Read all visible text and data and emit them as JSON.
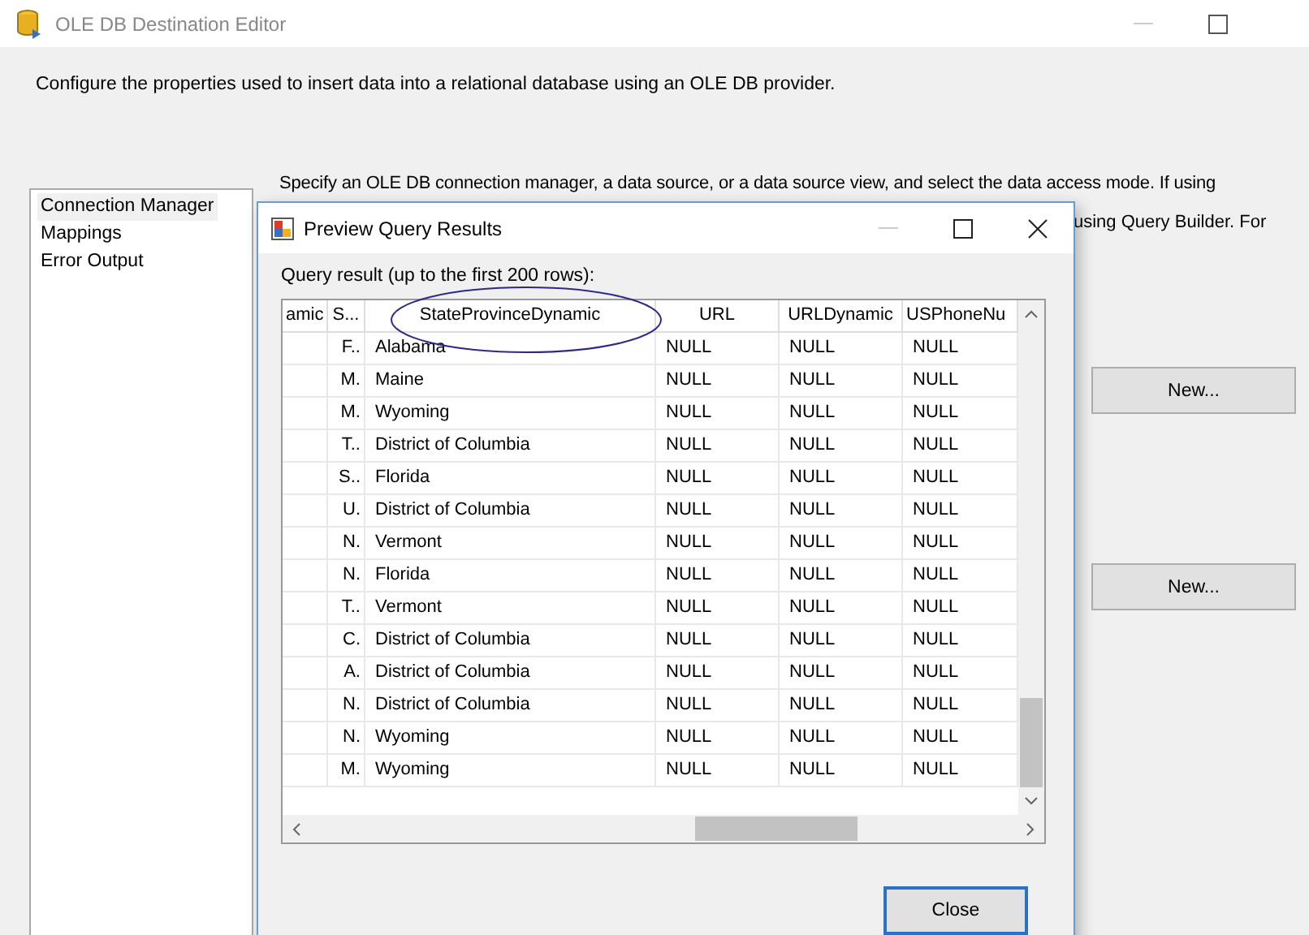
{
  "window": {
    "title": "OLE DB Destination Editor"
  },
  "description": "Configure the properties used to insert data into a relational database using an OLE DB provider.",
  "sidebar": {
    "items": [
      {
        "label": "Connection Manager",
        "selected": true
      },
      {
        "label": "Mappings",
        "selected": false
      },
      {
        "label": "Error Output",
        "selected": false
      }
    ]
  },
  "content": {
    "text_lines": [
      "Specify an OLE DB connection manager, a data source, or a data source view, and select the data access mode. If using",
      "using Query Builder. For"
    ],
    "buttons": [
      "New...",
      "New..."
    ]
  },
  "dialog": {
    "title": "Preview Query Results",
    "label": "Query result (up to the first 200 rows):",
    "table": {
      "columns": [
        "amic",
        "S...",
        "StateProvinceDynamic",
        "URL",
        "URLDynamic",
        "USPhoneNu"
      ],
      "rows": [
        [
          "",
          "F..",
          "Alabama",
          "NULL",
          "NULL",
          "NULL"
        ],
        [
          "",
          "M.",
          "Maine",
          "NULL",
          "NULL",
          "NULL"
        ],
        [
          "",
          "M.",
          "Wyoming",
          "NULL",
          "NULL",
          "NULL"
        ],
        [
          "",
          "T..",
          "District of Columbia",
          "NULL",
          "NULL",
          "NULL"
        ],
        [
          "",
          "S..",
          "Florida",
          "NULL",
          "NULL",
          "NULL"
        ],
        [
          "",
          "U.",
          "District of Columbia",
          "NULL",
          "NULL",
          "NULL"
        ],
        [
          "",
          "N.",
          "Vermont",
          "NULL",
          "NULL",
          "NULL"
        ],
        [
          "",
          "N.",
          "Florida",
          "NULL",
          "NULL",
          "NULL"
        ],
        [
          "",
          "T..",
          "Vermont",
          "NULL",
          "NULL",
          "NULL"
        ],
        [
          "",
          "C.",
          "District of Columbia",
          "NULL",
          "NULL",
          "NULL"
        ],
        [
          "",
          "A.",
          "District of Columbia",
          "NULL",
          "NULL",
          "NULL"
        ],
        [
          "",
          "N.",
          "District of Columbia",
          "NULL",
          "NULL",
          "NULL"
        ],
        [
          "",
          "N.",
          "Wyoming",
          "NULL",
          "NULL",
          "NULL"
        ],
        [
          "",
          "M.",
          "Wyoming",
          "NULL",
          "NULL",
          "NULL"
        ]
      ]
    },
    "buttons": [
      "Close"
    ]
  }
}
